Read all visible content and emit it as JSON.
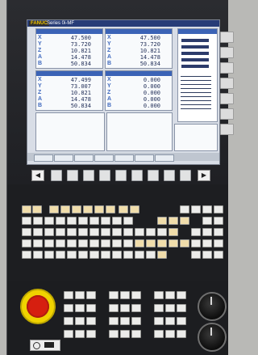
{
  "header": {
    "brand": "FANUC",
    "model": "Series 0i-MF"
  },
  "blocks": {
    "top_left_axes": [
      "X",
      "Y",
      "Z",
      "A",
      "B"
    ],
    "top_left_values": [
      "47.500",
      "73.720",
      "10.821",
      "14.478",
      "50.834"
    ],
    "top_middle_values": [
      "47.500",
      "73.720",
      "10.821",
      "14.478",
      "50.834"
    ],
    "bottom_left_axes": [
      "X",
      "Y",
      "Z",
      "A",
      "B"
    ],
    "bottom_left_values": [
      "47.499",
      "73.007",
      "10.821",
      "14.478",
      "50.834"
    ],
    "bottom_middle_values": [
      "0.000",
      "0.000",
      "0.000",
      "0.000",
      "0.000"
    ]
  },
  "status": {
    "softkeys": [
      "",
      "",
      "",
      "",
      "",
      "",
      ""
    ]
  }
}
